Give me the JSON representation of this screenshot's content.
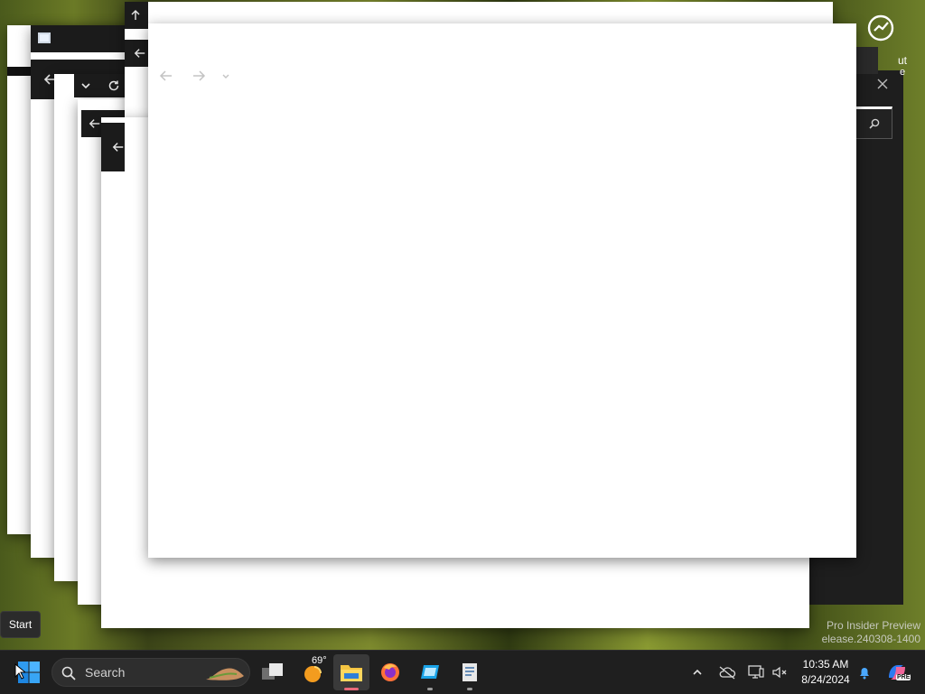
{
  "front_window": {
    "nav": {
      "back_icon": "arrow-left-icon",
      "forward_icon": "arrow-right-icon",
      "recent_icon": "chevron-down-icon"
    }
  },
  "right_panel": {
    "label_fragment_1": "ut",
    "label_fragment_2": "e",
    "close_icon": "close-icon",
    "search_icon": "search-icon"
  },
  "tooltip": {
    "start": "Start"
  },
  "watermark": {
    "line1": "Pro Insider Preview",
    "line2": "elease.240308-1400"
  },
  "taskbar": {
    "start_icon": "windows-logo-icon",
    "search_placeholder": "Search",
    "weather_temp": "69°",
    "apps": [
      {
        "name": "task-view",
        "icon": "task-view-icon"
      },
      {
        "name": "weather",
        "icon": "weather-sun-icon"
      },
      {
        "name": "file-explorer",
        "icon": "folder-icon",
        "active": true
      },
      {
        "name": "firefox",
        "icon": "firefox-icon"
      },
      {
        "name": "app-blue",
        "icon": "blue-app-icon"
      },
      {
        "name": "notepad",
        "icon": "document-icon"
      }
    ],
    "tray": {
      "chevron": "chevron-up-icon",
      "clock_time": "10:35 AM",
      "clock_date": "8/24/2024",
      "badge": "PRE"
    }
  },
  "colors": {
    "taskbar_bg": "#1f1f1f",
    "accent_active": "#e8697a",
    "folder_yellow": "#f4c542",
    "windows_blue": "#1e90ff"
  }
}
